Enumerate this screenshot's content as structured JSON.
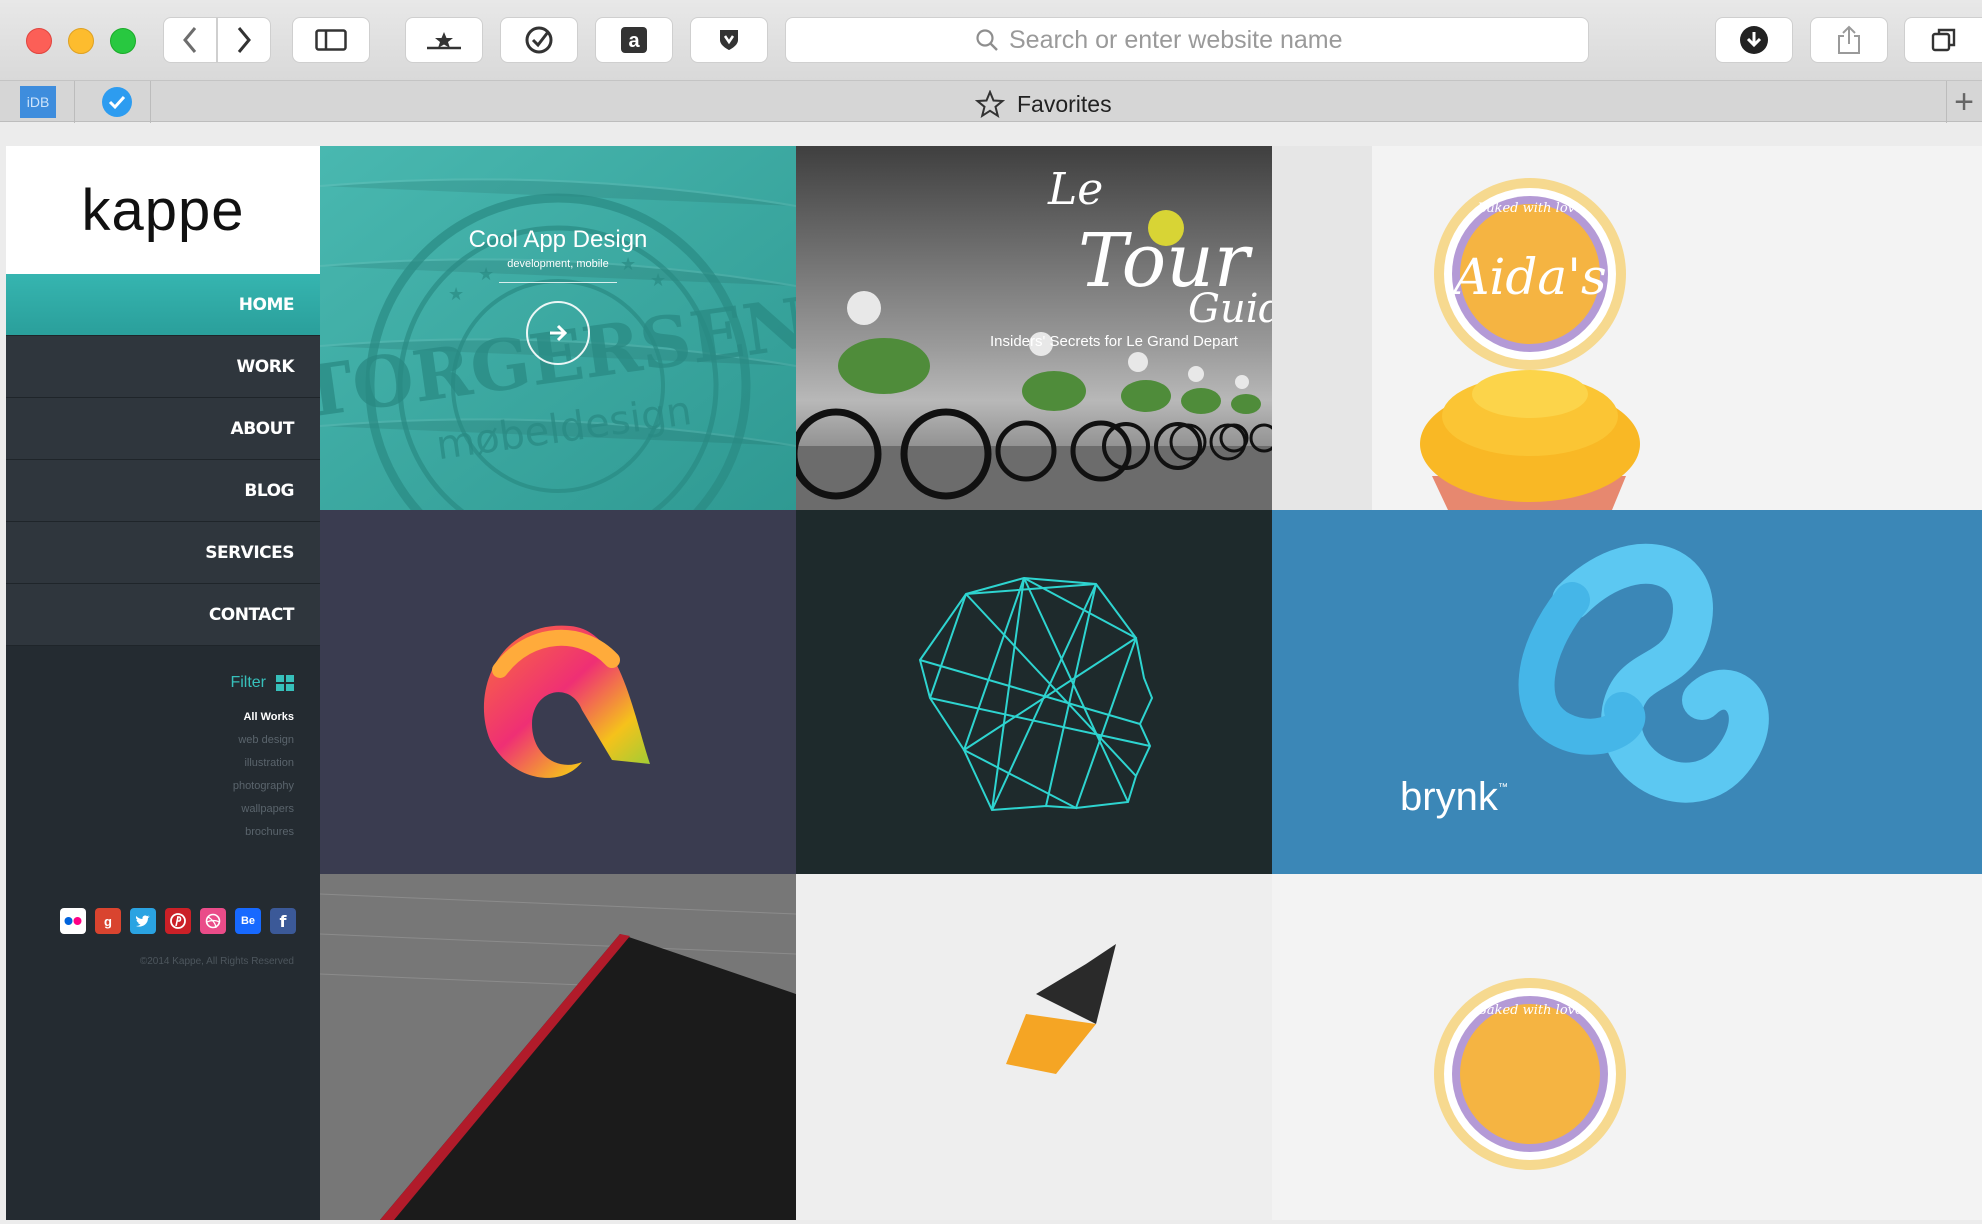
{
  "browser": {
    "url_placeholder": "Search or enter website name",
    "favorites_title": "Favorites",
    "bookmark_idb": "iDB"
  },
  "site": {
    "logo": "kappe",
    "nav": [
      {
        "label": "HOME",
        "active": true
      },
      {
        "label": "WORK",
        "active": false
      },
      {
        "label": "ABOUT",
        "active": false
      },
      {
        "label": "BLOG",
        "active": false
      },
      {
        "label": "SERVICES",
        "active": false
      },
      {
        "label": "CONTACT",
        "active": false
      }
    ],
    "filter": {
      "title": "Filter",
      "items": [
        "All Works",
        "web design",
        "illustration",
        "photography",
        "wallpapers",
        "brochures"
      ]
    },
    "social": [
      "flickr",
      "google-plus",
      "twitter",
      "pinterest",
      "dribbble",
      "behance",
      "facebook"
    ],
    "copyright": "©2014 Kappe, All Rights Reserved"
  },
  "portfolio": {
    "featured": {
      "title": "Cool App Design",
      "subtitle": "development, mobile",
      "stamp_name": "TORGERSEN",
      "stamp_sub": "møbeldesign"
    },
    "tour": {
      "title_1": "Le",
      "title_2": "Tour",
      "title_3": "Guide",
      "tagline": "Insiders' Secrets for Le Grand Depart"
    },
    "aida": {
      "badge_top": "Baked with love",
      "name": "Aida's"
    },
    "brynk": {
      "name": "brynk",
      "tm": "™"
    }
  }
}
